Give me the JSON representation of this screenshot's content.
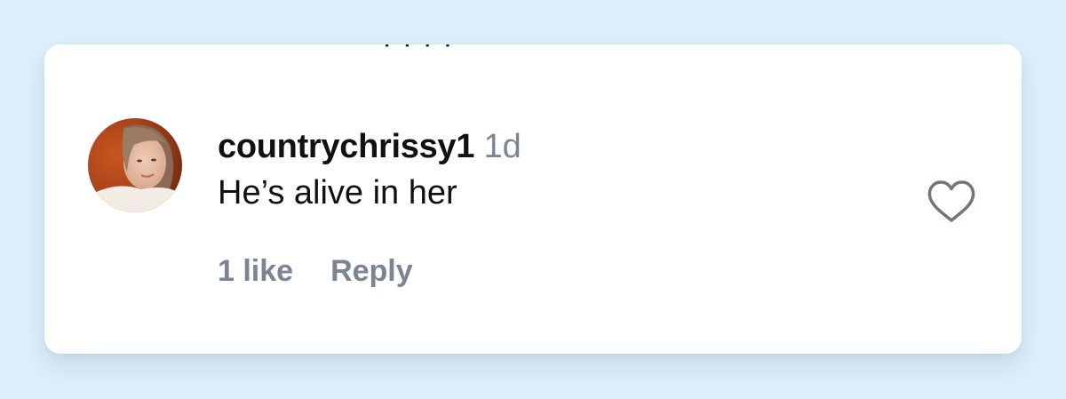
{
  "comment": {
    "avatar_icon": "user-avatar-photo",
    "username": "countrychrissy1",
    "timestamp": "1d",
    "text": "He’s alive in her",
    "like_icon": "heart-outline-icon"
  },
  "actions": {
    "likes_label": "1 like",
    "reply_label": "Reply"
  },
  "colors": {
    "background": "#dfeefb",
    "card": "#ffffff",
    "text_primary": "#111111",
    "text_muted": "#7b8492"
  }
}
